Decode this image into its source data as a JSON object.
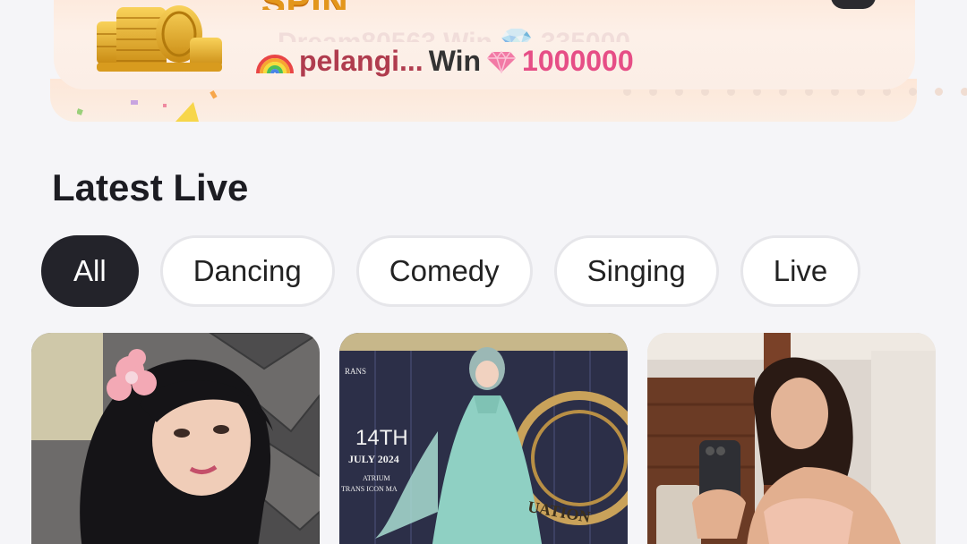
{
  "banner": {
    "title": "SPIN",
    "ghost_text": "Dream80563 Win 💎 335000",
    "winner": {
      "name": "pelangi...",
      "win_label": "Win",
      "amount": "1000000"
    }
  },
  "section": {
    "title": "Latest Live"
  },
  "filters": [
    {
      "label": "All",
      "active": true
    },
    {
      "label": "Dancing",
      "active": false
    },
    {
      "label": "Comedy",
      "active": false
    },
    {
      "label": "Singing",
      "active": false
    },
    {
      "label": "Live",
      "active": false
    }
  ],
  "cards": [
    {
      "thumbnail": "woman-black-hijab-pink-flower"
    },
    {
      "thumbnail": "woman-teal-gown-graduation-poster",
      "poster": {
        "date_big": "14TH",
        "date_small": "JULY 2024",
        "venue1": "ATRIUM",
        "venue2": "TRANS ICON MA",
        "brand": "RANS",
        "badge": "UATION"
      }
    },
    {
      "thumbnail": "woman-mirror-selfie"
    }
  ],
  "colors": {
    "chip_active_bg": "#23232a",
    "winner_amount": "#e64e86",
    "winner_name": "#b03c4e",
    "banner_title": "#e3961b"
  }
}
